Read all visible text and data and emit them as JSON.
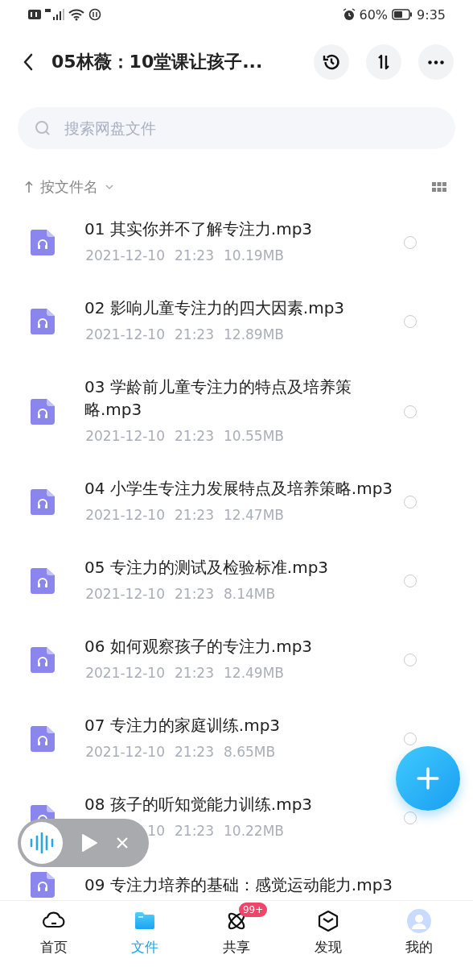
{
  "status_bar": {
    "battery": "60%",
    "time": "9:35"
  },
  "header": {
    "title": "05林薇：10堂课让孩子..."
  },
  "search": {
    "placeholder": "搜索网盘文件"
  },
  "sort": {
    "label": "按文件名"
  },
  "files": [
    {
      "name": "01 其实你并不了解专注力.mp3",
      "date": "2021-12-10",
      "time": "21:23",
      "size": "10.19MB",
      "checked": false
    },
    {
      "name": "02 影响儿童专注力的四大因素.mp3",
      "date": "2021-12-10",
      "time": "21:23",
      "size": "12.89MB",
      "checked": false
    },
    {
      "name": "03 学龄前儿童专注力的特点及培养策略.mp3",
      "date": "2021-12-10",
      "time": "21:23",
      "size": "10.55MB",
      "checked": false
    },
    {
      "name": "04 小学生专注力发展特点及培养策略.mp3",
      "date": "2021-12-10",
      "time": "21:23",
      "size": "12.47MB",
      "checked": false
    },
    {
      "name": "05 专注力的测试及检验标准.mp3",
      "date": "2021-12-10",
      "time": "21:23",
      "size": "8.14MB",
      "checked": false
    },
    {
      "name": "06 如何观察孩子的专注力.mp3",
      "date": "2021-12-10",
      "time": "21:23",
      "size": "12.49MB",
      "checked": false
    },
    {
      "name": "07 专注力的家庭训练.mp3",
      "date": "2021-12-10",
      "time": "21:23",
      "size": "8.65MB",
      "checked": false
    },
    {
      "name": "08 孩子的听知觉能力训练.mp3",
      "date": "10",
      "time": "21:23",
      "size": "10.22MB",
      "checked": false
    },
    {
      "name": "09 专注力培养的基础：感觉运动能力.mp3"
    }
  ],
  "tabs": [
    {
      "kind": "home",
      "label": "首页",
      "selected": false
    },
    {
      "kind": "files",
      "label": "文件",
      "selected": true
    },
    {
      "kind": "share",
      "label": "共享",
      "selected": false,
      "badge": "99+"
    },
    {
      "kind": "discover",
      "label": "发现",
      "selected": false
    },
    {
      "kind": "me",
      "label": "我的",
      "selected": false
    }
  ]
}
